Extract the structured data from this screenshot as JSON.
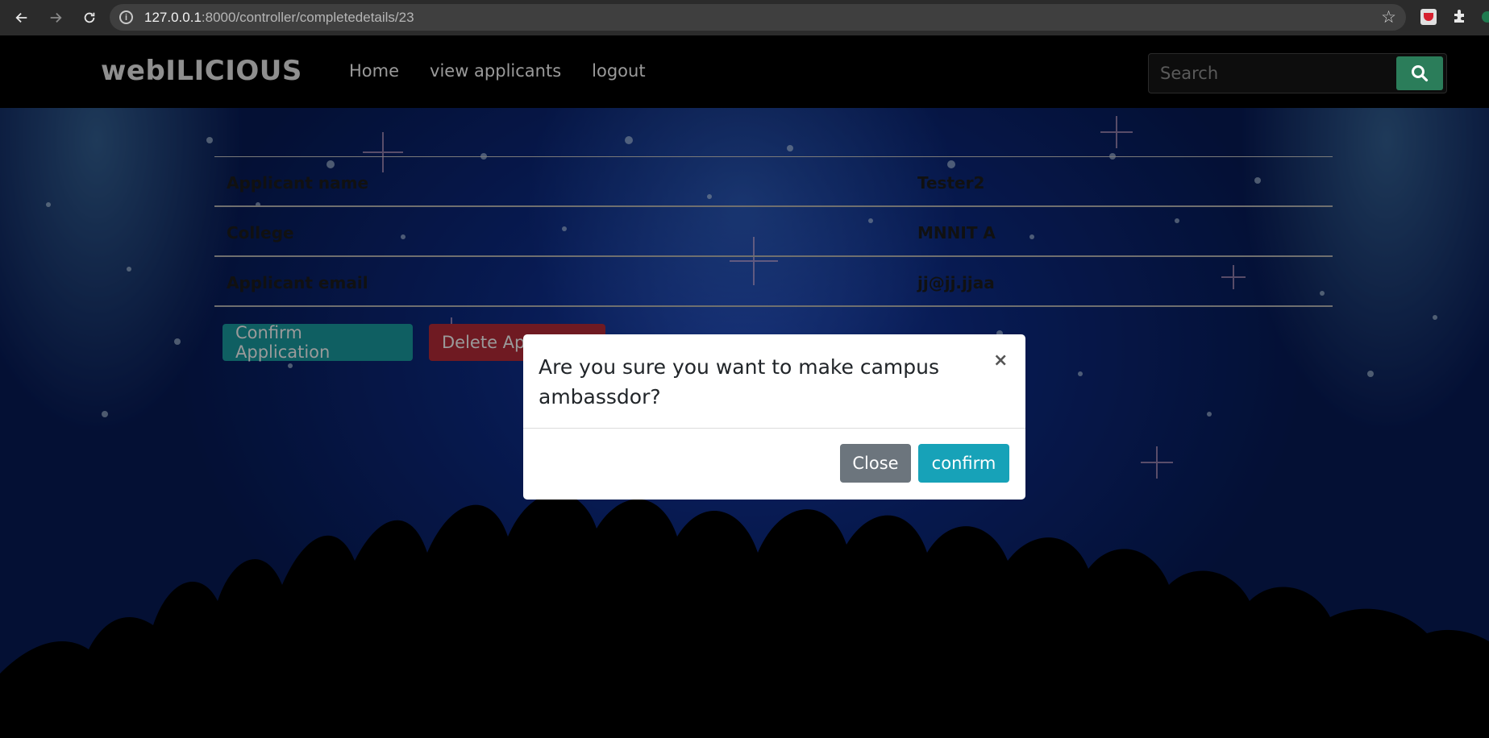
{
  "browser": {
    "url_host": "127.0.0.1",
    "url_path": ":8000/controller/completedetails/23"
  },
  "navbar": {
    "brand": "webILICIOUS",
    "links": [
      {
        "label": "Home"
      },
      {
        "label": "view applicants"
      },
      {
        "label": "logout"
      }
    ],
    "search_placeholder": "Search"
  },
  "details": [
    {
      "label": "Applicant name",
      "value": "Tester2"
    },
    {
      "label": "College",
      "value": "MNNIT A"
    },
    {
      "label": "Applicant email",
      "value": "jj@jj.jjaa"
    }
  ],
  "actions": {
    "confirm_label": "Confirm Application",
    "delete_label": "Delete Application"
  },
  "modal": {
    "title": "Are you sure you want to make campus ambassdor?",
    "close_x": "×",
    "close_label": "Close",
    "confirm_label": "confirm"
  },
  "colors": {
    "confirm_button": "#17a2b8",
    "close_button": "#6c757d",
    "search_button": "#2b7d5a",
    "delete_button": "#dc3545"
  }
}
